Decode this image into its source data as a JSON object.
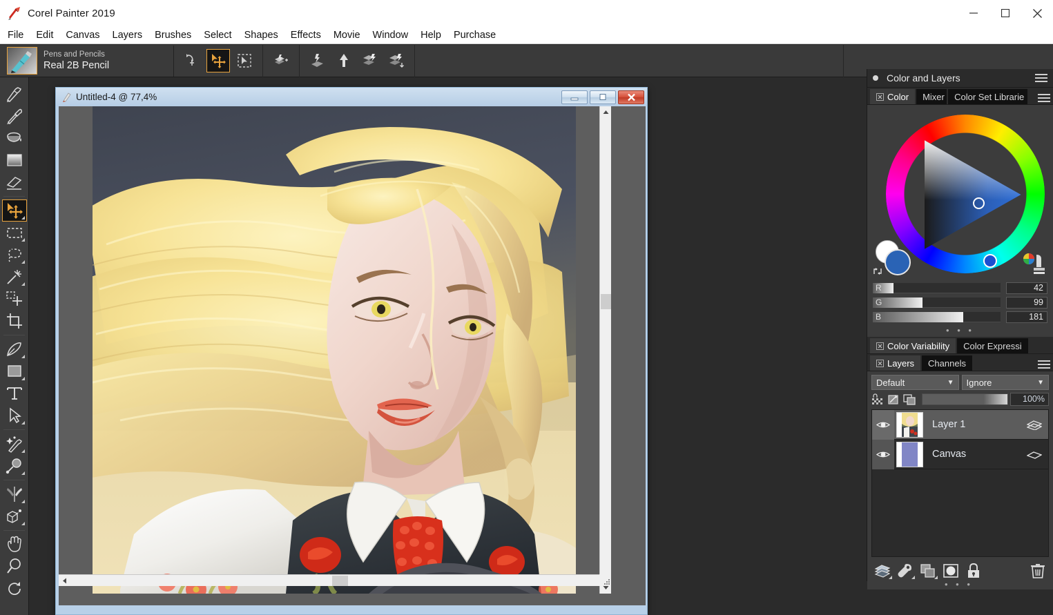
{
  "window": {
    "app_title": "Corel Painter 2019",
    "app_icon": "corel-painter-icon",
    "controls": {
      "minimize": "minimize-icon",
      "maximize": "maximize-icon",
      "close": "close-icon"
    }
  },
  "menubar": {
    "items": [
      {
        "label": "File"
      },
      {
        "label": "Edit"
      },
      {
        "label": "Canvas"
      },
      {
        "label": "Layers"
      },
      {
        "label": "Brushes"
      },
      {
        "label": "Select"
      },
      {
        "label": "Shapes"
      },
      {
        "label": "Effects"
      },
      {
        "label": "Movie"
      },
      {
        "label": "Window"
      },
      {
        "label": "Help"
      },
      {
        "label": "Purchase"
      }
    ]
  },
  "property_bar": {
    "brush_category": "Pens and Pencils",
    "brush_variant": "Real 2B Pencil",
    "brush_thumb_icon": "pencil-brush-icon",
    "tools": [
      {
        "name": "free-transform-icon",
        "active": false
      },
      {
        "name": "layer-adjuster-icon",
        "active": true
      },
      {
        "name": "selection-adjuster-icon",
        "active": false
      },
      {
        "name": "add-layer-mask-icon",
        "active": false
      },
      {
        "name": "drop-layer-icon",
        "active": false
      },
      {
        "name": "lift-layer-icon",
        "active": false
      },
      {
        "name": "group-layers-icon",
        "active": false
      },
      {
        "name": "collapse-layers-icon",
        "active": false
      }
    ]
  },
  "toolbox": {
    "tools": [
      {
        "name": "brush-tool-icon",
        "selected": false,
        "flyout": false
      },
      {
        "name": "dropper-tool-icon",
        "selected": false,
        "flyout": false
      },
      {
        "name": "paint-bucket-tool-icon",
        "selected": false,
        "flyout": false
      },
      {
        "name": "gradient-tool-icon",
        "selected": false,
        "flyout": false
      },
      {
        "name": "eraser-tool-icon",
        "selected": false,
        "flyout": false
      },
      {
        "name": "layer-adjuster-tool-icon",
        "selected": true,
        "flyout": true
      },
      {
        "name": "rectangular-selection-tool-icon",
        "selected": false,
        "flyout": true
      },
      {
        "name": "lasso-tool-icon",
        "selected": false,
        "flyout": true
      },
      {
        "name": "magic-wand-tool-icon",
        "selected": false,
        "flyout": true
      },
      {
        "name": "selection-adjuster-tool-icon",
        "selected": false,
        "flyout": false
      },
      {
        "name": "crop-tool-icon",
        "selected": false,
        "flyout": false
      },
      {
        "name": "pen-tool-icon",
        "selected": false,
        "flyout": true
      },
      {
        "name": "shape-tool-icon",
        "selected": false,
        "flyout": true
      },
      {
        "name": "text-tool-icon",
        "selected": false,
        "flyout": false
      },
      {
        "name": "shape-selection-tool-icon",
        "selected": false,
        "flyout": true
      },
      {
        "name": "cloner-tool-icon",
        "selected": false,
        "flyout": true
      },
      {
        "name": "divine-proportion-tool-icon",
        "selected": false,
        "flyout": true
      },
      {
        "name": "mirror-painting-tool-icon",
        "selected": false,
        "flyout": true
      },
      {
        "name": "perspective-guide-tool-icon",
        "selected": false,
        "flyout": true
      },
      {
        "name": "grabber-hand-tool-icon",
        "selected": false,
        "flyout": false
      },
      {
        "name": "magnifier-tool-icon",
        "selected": false,
        "flyout": false
      },
      {
        "name": "rotate-page-tool-icon",
        "selected": false,
        "flyout": false
      }
    ]
  },
  "document": {
    "title": "Untitled-4 @ 77,4%",
    "title_icon": "document-icon",
    "controls": {
      "minimize": "doc-minimize-icon",
      "restore": "doc-restore-icon",
      "close": "doc-close-icon"
    },
    "artwork_description": "Digital painting portrait of a blonde woman with yellow eyes wearing a traditional folk costume with white embroidered blouse, dark vest with red roses and red coral necklace",
    "scrollbars": {
      "vertical": {
        "up": "scroll-up-icon",
        "down": "scroll-down-icon"
      },
      "horizontal": {
        "left": "scroll-left-icon",
        "right": "scroll-right-icon"
      }
    }
  },
  "dock": {
    "title": "Color and Layers",
    "menu_icon": "panel-menu-icon",
    "color": {
      "tabs": [
        {
          "label": "Color",
          "active": true,
          "closable": true
        },
        {
          "label": "Mixer",
          "active": false,
          "closable": false
        },
        {
          "label": "Color Set Librarie",
          "active": false,
          "closable": false
        }
      ],
      "menu_icon": "color-panel-menu-icon",
      "wheel": {
        "hue_marker_color": "#1b4fd0",
        "front_swatch": "#2a63b5",
        "back_swatch": "#ffffff",
        "swap_icon": "swap-colors-icon",
        "picker_icon": "color-picker-stamp-icon"
      },
      "sliders": [
        {
          "label": "R",
          "value": "42",
          "percent": 16
        },
        {
          "label": "G",
          "value": "99",
          "percent": 39
        },
        {
          "label": "B",
          "value": "181",
          "percent": 71
        }
      ],
      "expander": "• • •"
    },
    "variability": {
      "tabs": [
        {
          "label": "Color Variability",
          "active": true,
          "closable": true
        },
        {
          "label": "Color Expressi",
          "active": false,
          "closable": false
        }
      ]
    },
    "layers": {
      "tabs": [
        {
          "label": "Layers",
          "active": true,
          "closable": true
        },
        {
          "label": "Channels",
          "active": false,
          "closable": false
        }
      ],
      "menu_icon": "layers-panel-menu-icon",
      "composite_method": "Default",
      "composite_depth": "Ignore",
      "opacity": "100%",
      "toggles": [
        {
          "name": "lock-transparency-icon"
        },
        {
          "name": "preserve-transparency-icon"
        },
        {
          "name": "pick-up-underlying-color-icon"
        }
      ],
      "rows": [
        {
          "name": "Layer 1",
          "visible": true,
          "selected": true,
          "thumb": "artwork-thumb",
          "prop_icon": "layer-properties-icon"
        },
        {
          "name": "Canvas",
          "visible": true,
          "selected": false,
          "thumb": "canvas-thumb",
          "prop_icon": "canvas-properties-icon"
        }
      ],
      "buttons": [
        {
          "name": "new-layer-icon"
        },
        {
          "name": "dynamic-plugins-icon"
        },
        {
          "name": "duplicate-layer-icon"
        },
        {
          "name": "new-layer-mask-icon"
        },
        {
          "name": "lock-layer-icon"
        },
        {
          "name": "delete-layer-icon"
        }
      ],
      "expander": "• • •"
    }
  },
  "colors": {
    "accent_orange": "#e8a33d",
    "panel_bg": "#3c3c3c",
    "dark_bg": "#2b2b2b",
    "titlebar_bg": "#ffffff",
    "doc_chrome": "#b8d0e8"
  }
}
